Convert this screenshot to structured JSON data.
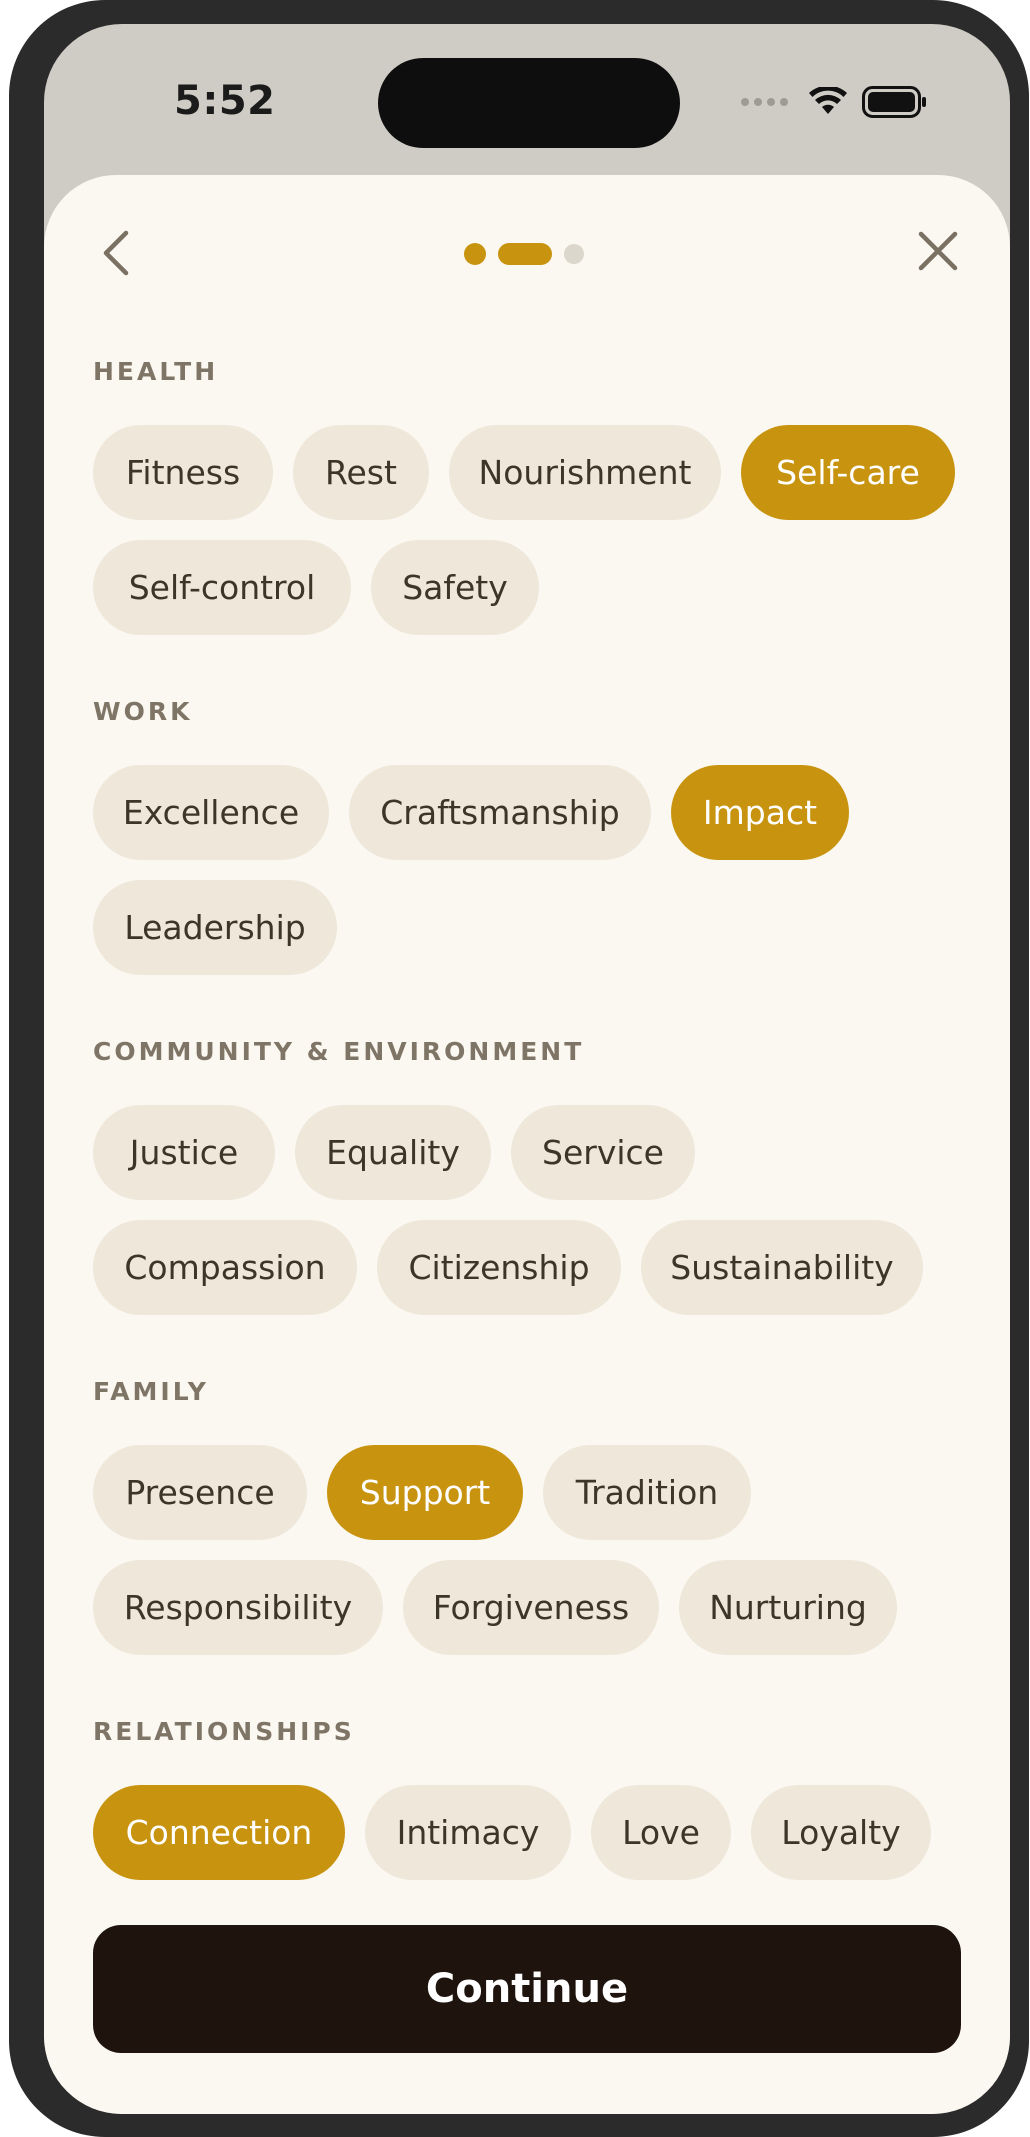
{
  "status_bar": {
    "time": "5:52",
    "icons": [
      "cellular-dots-icon",
      "wifi-icon",
      "battery-icon"
    ]
  },
  "navigation": {
    "back_icon": "chevron-left-icon",
    "close_icon": "close-icon",
    "progress_step": 2,
    "progress_total": 3
  },
  "colors": {
    "accent": "#c8940f",
    "chip_bg": "#eee7da",
    "sheet_bg": "#fbf8f1",
    "button_bg": "#1e140d"
  },
  "sections": {
    "health": {
      "title": "HEALTH",
      "chips": [
        {
          "label": "Fitness",
          "selected": false
        },
        {
          "label": "Rest",
          "selected": false
        },
        {
          "label": "Nourishment",
          "selected": false
        },
        {
          "label": "Self-care",
          "selected": true
        },
        {
          "label": "Self-control",
          "selected": false
        },
        {
          "label": "Safety",
          "selected": false
        }
      ]
    },
    "work": {
      "title": "WORK",
      "chips": [
        {
          "label": "Excellence",
          "selected": false
        },
        {
          "label": "Craftsmanship",
          "selected": false
        },
        {
          "label": "Impact",
          "selected": true
        },
        {
          "label": "Leadership",
          "selected": false
        }
      ]
    },
    "community": {
      "title": "COMMUNITY & ENVIRONMENT",
      "chips": [
        {
          "label": "Justice",
          "selected": false
        },
        {
          "label": "Equality",
          "selected": false
        },
        {
          "label": "Service",
          "selected": false
        },
        {
          "label": "Compassion",
          "selected": false
        },
        {
          "label": "Citizenship",
          "selected": false
        },
        {
          "label": "Sustainability",
          "selected": false
        }
      ]
    },
    "family": {
      "title": "FAMILY",
      "chips": [
        {
          "label": "Presence",
          "selected": false
        },
        {
          "label": "Support",
          "selected": true
        },
        {
          "label": "Tradition",
          "selected": false
        },
        {
          "label": "Responsibility",
          "selected": false
        },
        {
          "label": "Forgiveness",
          "selected": false
        },
        {
          "label": "Nurturing",
          "selected": false
        }
      ]
    },
    "relationships": {
      "title": "RELATIONSHIPS",
      "chips": [
        {
          "label": "Connection",
          "selected": true
        },
        {
          "label": "Intimacy",
          "selected": false
        },
        {
          "label": "Love",
          "selected": false
        },
        {
          "label": "Loyalty",
          "selected": false
        }
      ]
    }
  },
  "continue_label": "Continue"
}
